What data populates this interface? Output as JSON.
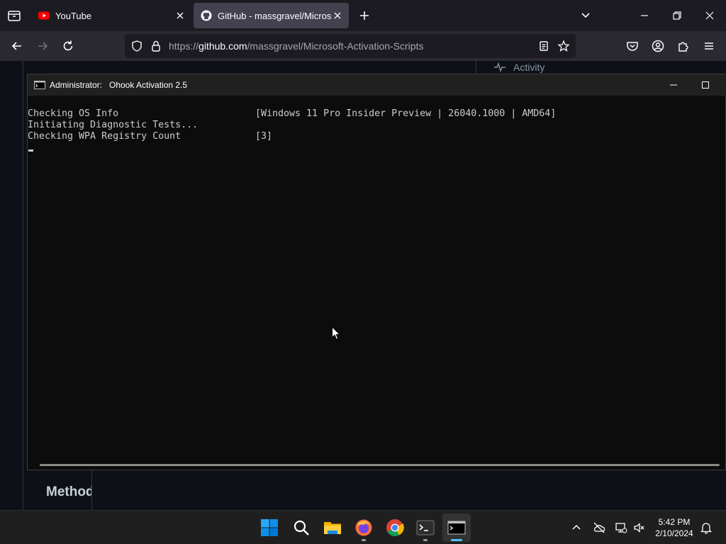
{
  "browser": {
    "tabs": [
      {
        "title": "YouTube",
        "active": false
      },
      {
        "title": "GitHub - massgravel/Microsoft-Activation-Scripts",
        "active": true
      }
    ],
    "url": {
      "scheme": "https://",
      "host": "github.com",
      "path": "/massgravel/Microsoft-Activation-Scripts"
    }
  },
  "page": {
    "activity_label": "Activity",
    "methods_heading": "Methods"
  },
  "console": {
    "title_user": "Administrator:",
    "title_name": "Ohook Activation 2.5",
    "lines": [
      {
        "label": "Checking OS Info",
        "value": "[Windows 11 Pro Insider Preview | 26040.1000 | AMD64]"
      },
      {
        "label": "Initiating Diagnostic Tests...",
        "value": ""
      },
      {
        "label": "Checking WPA Registry Count",
        "value": "[3]"
      }
    ]
  },
  "taskbar": {
    "time": "5:42 PM",
    "date": "2/10/2024"
  },
  "colors": {
    "accent": "#4cc2ff",
    "youtube": "#ff0000",
    "terminal_bg": "#0c0c0c",
    "terminal_text": "#cccccc"
  }
}
